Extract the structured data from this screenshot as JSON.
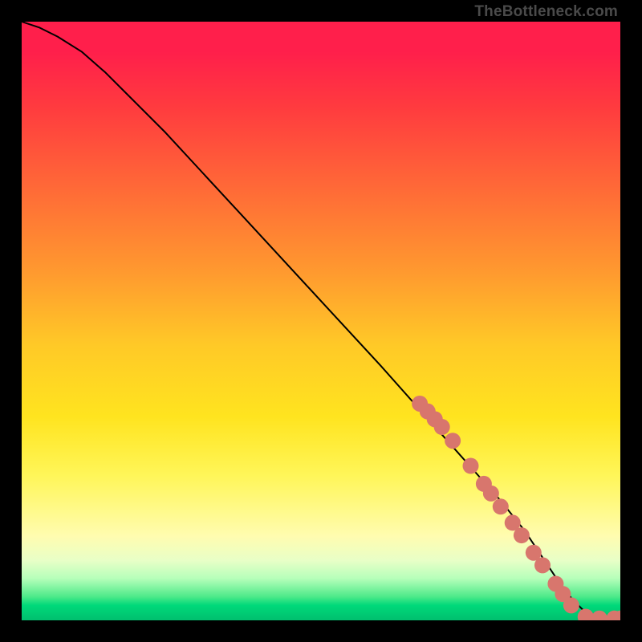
{
  "watermark": "TheBottleneck.com",
  "chart_data": {
    "type": "line",
    "title": "",
    "xlabel": "",
    "ylabel": "",
    "xlim": [
      0,
      100
    ],
    "ylim": [
      0,
      100
    ],
    "grid": false,
    "legend": false,
    "series": [
      {
        "name": "curve",
        "x": [
          0,
          3,
          6,
          10,
          14,
          18,
          24,
          30,
          36,
          42,
          48,
          54,
          60,
          64,
          68,
          72,
          76,
          80,
          84,
          88,
          90,
          92,
          94,
          96,
          98,
          100
        ],
        "y": [
          100,
          99,
          97.5,
          95,
          91.5,
          87.5,
          81.5,
          75,
          68.5,
          62,
          55.5,
          49,
          42.5,
          38,
          33.5,
          29,
          24.5,
          20,
          15,
          9,
          6,
          3.5,
          1.5,
          0.5,
          0.2,
          0.2
        ]
      }
    ],
    "markers": {
      "name": "highlighted-points",
      "color": "#d8766d",
      "radius_px": 10,
      "points": [
        {
          "x": 66.5,
          "y": 36.2
        },
        {
          "x": 67.8,
          "y": 34.9
        },
        {
          "x": 69.0,
          "y": 33.6
        },
        {
          "x": 70.2,
          "y": 32.3
        },
        {
          "x": 72.0,
          "y": 30.0
        },
        {
          "x": 75.0,
          "y": 25.8
        },
        {
          "x": 77.2,
          "y": 22.8
        },
        {
          "x": 78.4,
          "y": 21.2
        },
        {
          "x": 80.0,
          "y": 19.0
        },
        {
          "x": 82.0,
          "y": 16.3
        },
        {
          "x": 83.5,
          "y": 14.2
        },
        {
          "x": 85.5,
          "y": 11.3
        },
        {
          "x": 87.0,
          "y": 9.2
        },
        {
          "x": 89.2,
          "y": 6.1
        },
        {
          "x": 90.4,
          "y": 4.4
        },
        {
          "x": 91.8,
          "y": 2.5
        },
        {
          "x": 94.2,
          "y": 0.6
        },
        {
          "x": 96.5,
          "y": 0.3
        },
        {
          "x": 99.0,
          "y": 0.3
        },
        {
          "x": 100.0,
          "y": 0.3
        }
      ]
    }
  }
}
